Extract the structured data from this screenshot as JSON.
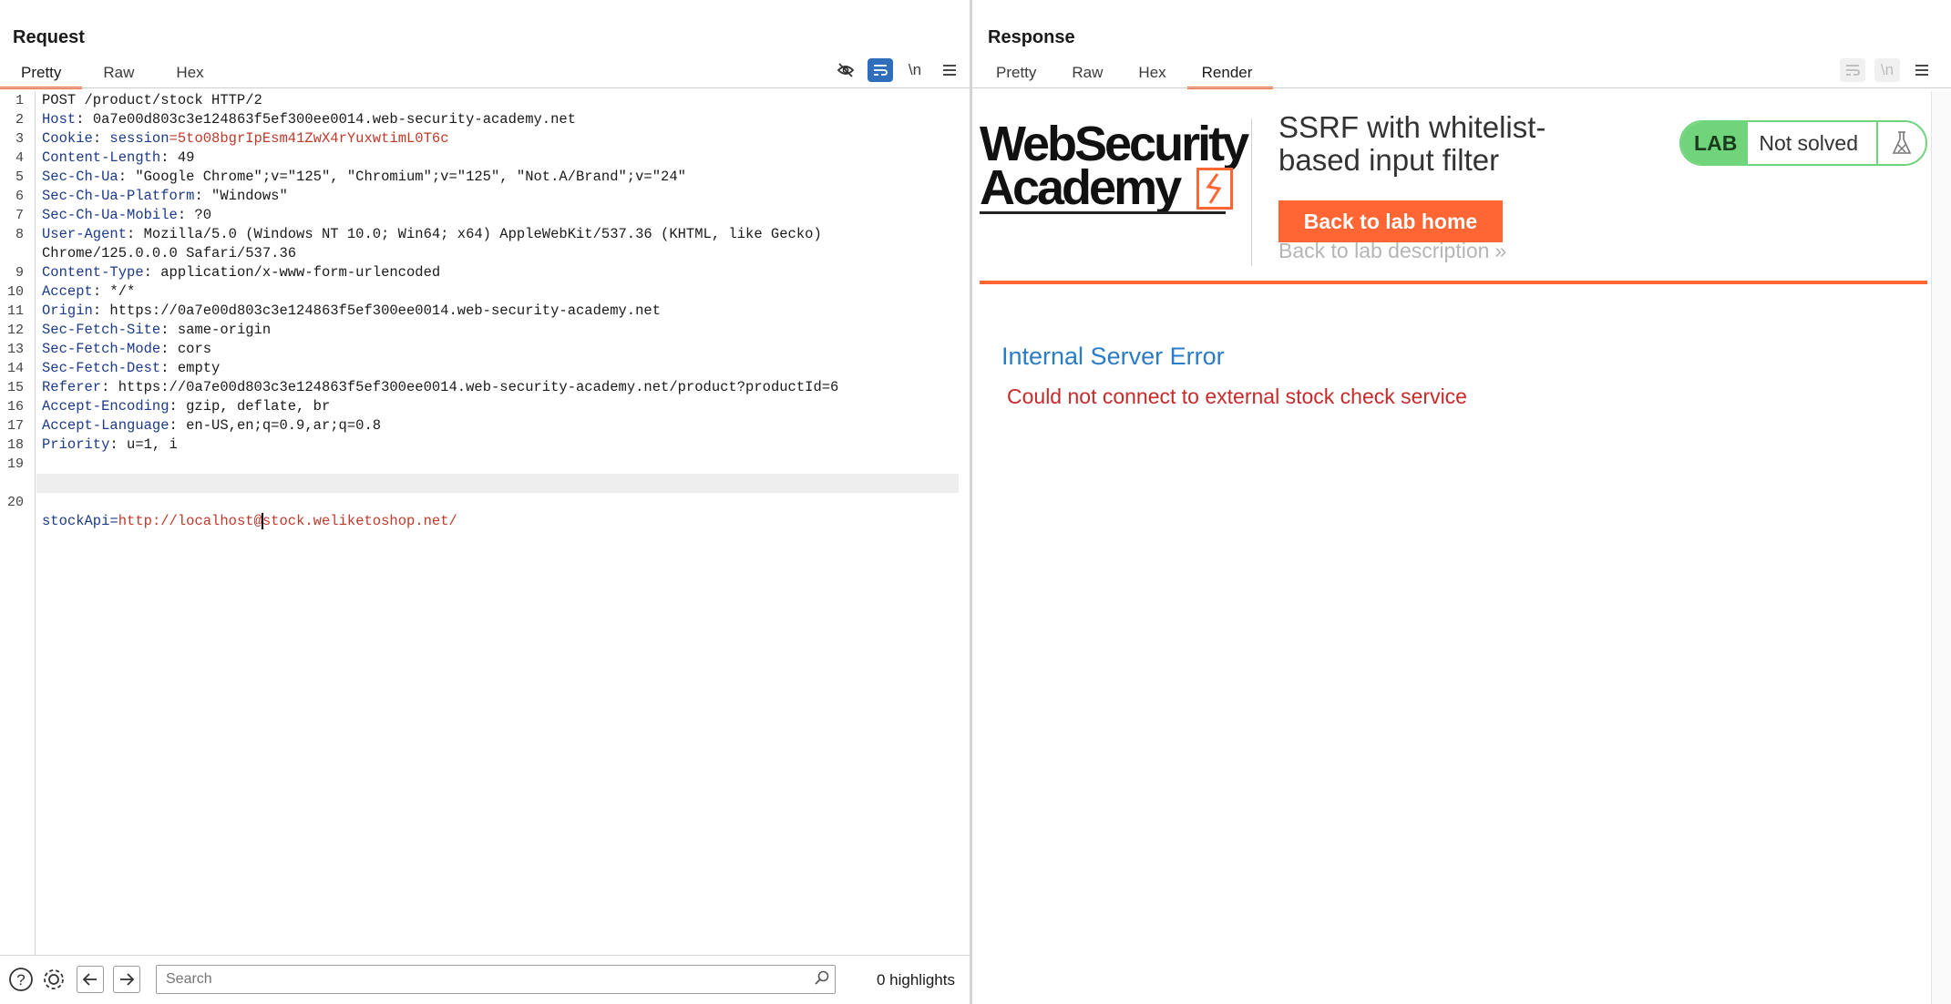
{
  "layout_toggle": {
    "icons": [
      "split-horizontal-icon",
      "split-vertical-icon",
      "single-pane-icon"
    ],
    "active_index": 0
  },
  "request": {
    "title": "Request",
    "tabs": [
      {
        "label": "Pretty",
        "active": true
      },
      {
        "label": "Raw",
        "active": false
      },
      {
        "label": "Hex",
        "active": false
      }
    ],
    "toolbar": {
      "hide_icon": "eye-slash-icon",
      "wrap_icon": "word-wrap-icon",
      "newline_label": "\\n",
      "menu_icon": "hamburger-menu-icon"
    },
    "lines": [
      {
        "n": "1",
        "header": "",
        "value": "POST /product/stock HTTP/2"
      },
      {
        "n": "2",
        "header": "Host",
        "value": ": 0a7e00d803c3e124863f5ef300ee0014.web-security-academy.net"
      },
      {
        "n": "3",
        "header": "Cookie",
        "value": ": ",
        "cookie_name": "session",
        "cookie_value": "=5to08bgrIpEsm41ZwX4rYuxwtimL0T6c"
      },
      {
        "n": "4",
        "header": "Content-Length",
        "value": ": 49"
      },
      {
        "n": "5",
        "header": "Sec-Ch-Ua",
        "value": ": \"Google Chrome\";v=\"125\", \"Chromium\";v=\"125\", \"Not.A/Brand\";v=\"24\""
      },
      {
        "n": "6",
        "header": "Sec-Ch-Ua-Platform",
        "value": ": \"Windows\""
      },
      {
        "n": "7",
        "header": "Sec-Ch-Ua-Mobile",
        "value": ": ?0"
      },
      {
        "n": "8",
        "header": "User-Agent",
        "value": ": Mozilla/5.0 (Windows NT 10.0; Win64; x64) AppleWebKit/537.36 (KHTML, like Gecko)"
      },
      {
        "n": "",
        "header": "",
        "value": "Chrome/125.0.0.0 Safari/537.36"
      },
      {
        "n": "9",
        "header": "Content-Type",
        "value": ": application/x-www-form-urlencoded"
      },
      {
        "n": "10",
        "header": "Accept",
        "value": ": */*"
      },
      {
        "n": "11",
        "header": "Origin",
        "value": ": https://0a7e00d803c3e124863f5ef300ee0014.web-security-academy.net"
      },
      {
        "n": "12",
        "header": "Sec-Fetch-Site",
        "value": ": same-origin"
      },
      {
        "n": "13",
        "header": "Sec-Fetch-Mode",
        "value": ": cors"
      },
      {
        "n": "14",
        "header": "Sec-Fetch-Dest",
        "value": ": empty"
      },
      {
        "n": "15",
        "header": "Referer",
        "value": ": https://0a7e00d803c3e124863f5ef300ee0014.web-security-academy.net/product?productId=6"
      },
      {
        "n": "16",
        "header": "Accept-Encoding",
        "value": ": gzip, deflate, br"
      },
      {
        "n": "17",
        "header": "Accept-Language",
        "value": ": en-US,en;q=0.9,ar;q=0.8"
      },
      {
        "n": "18",
        "header": "Priority",
        "value": ": u=1, i"
      },
      {
        "n": "19",
        "header": "",
        "value": ""
      }
    ],
    "body_line": {
      "n": "20",
      "param": "stockApi",
      "eq": "=",
      "value_before_caret": "http://localhost@",
      "value_after_caret": "stock.weliketoshop.net/"
    },
    "bottom": {
      "help_icon": "help-icon",
      "settings_icon": "gear-icon",
      "back_icon": "arrow-left-icon",
      "forward_icon": "arrow-right-icon",
      "search_placeholder": "Search",
      "search_icon": "search-icon",
      "highlights": "0 highlights"
    }
  },
  "response": {
    "title": "Response",
    "tabs": [
      {
        "label": "Pretty",
        "active": false
      },
      {
        "label": "Raw",
        "active": false
      },
      {
        "label": "Hex",
        "active": false
      },
      {
        "label": "Render",
        "active": true
      }
    ],
    "toolbar": {
      "wrap_icon": "word-wrap-icon",
      "newline_label": "\\n",
      "menu_icon": "hamburger-menu-icon"
    },
    "render": {
      "logo_line1": "WebSecurity",
      "logo_line2": "Academy",
      "lab_title": "SSRF with whitelist-based input filter",
      "back_home": "Back to lab home",
      "back_desc": "Back to lab description",
      "back_desc_chevron": "»",
      "badge_lab": "LAB",
      "badge_status": "Not solved",
      "badge_icon": "flask-icon",
      "error_heading": "Internal Server Error",
      "error_message": "Could not connect to external stock check service"
    }
  },
  "colors": {
    "accent_orange": "#ff6633",
    "selected_blue": "#2f6eba",
    "header_name_blue": "#1c3a8a",
    "value_red": "#c0392b",
    "error_blue": "#2b7cc6",
    "error_red": "#c72a2a",
    "lab_green": "#70d47a"
  }
}
